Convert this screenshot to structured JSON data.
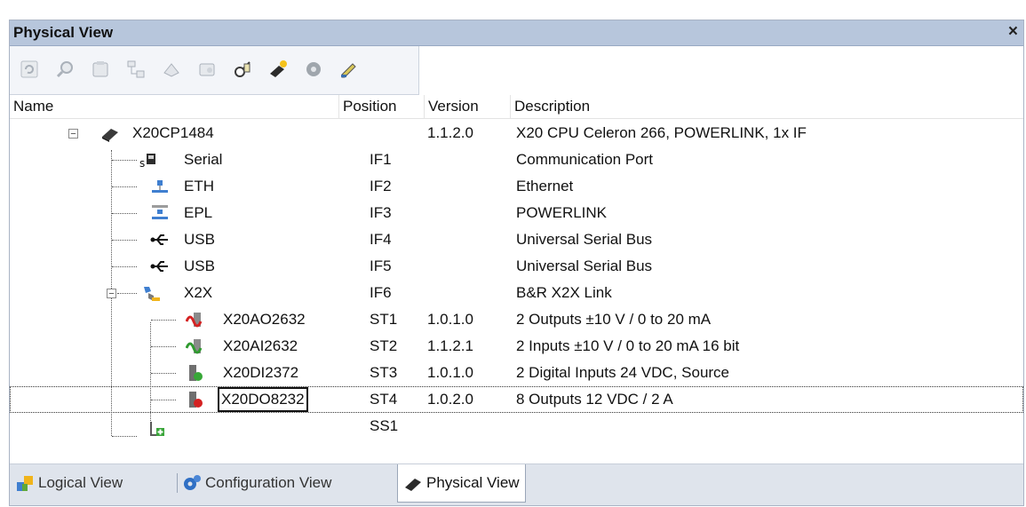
{
  "window": {
    "title": "Physical View",
    "close_label": "×"
  },
  "toolbar": {
    "buttons": [
      "refresh-icon",
      "search-icon",
      "module-icon",
      "hierarchy-icon",
      "compare-icon",
      "open-icon",
      "find-icon",
      "insert-hardware-icon",
      "gear-icon",
      "properties-icon"
    ]
  },
  "columns": {
    "name": "Name",
    "position": "Position",
    "version": "Version",
    "description": "Description"
  },
  "rows": [
    {
      "name": "X20CP1484",
      "position": "",
      "version": "1.1.2.0",
      "description": "X20 CPU Celeron 266, POWERLINK, 1x IF",
      "icon": "cpu-icon"
    },
    {
      "name": "Serial",
      "position": "IF1",
      "version": "",
      "description": "Communication Port",
      "icon": "serial-port-icon"
    },
    {
      "name": "ETH",
      "position": "IF2",
      "version": "",
      "description": "Ethernet",
      "icon": "ethernet-icon"
    },
    {
      "name": "EPL",
      "position": "IF3",
      "version": "",
      "description": "POWERLINK",
      "icon": "powerlink-icon"
    },
    {
      "name": "USB",
      "position": "IF4",
      "version": "",
      "description": "Universal Serial Bus",
      "icon": "usb-icon"
    },
    {
      "name": "USB",
      "position": "IF5",
      "version": "",
      "description": "Universal Serial Bus",
      "icon": "usb-icon"
    },
    {
      "name": "X2X",
      "position": "IF6",
      "version": "",
      "description": "B&R X2X Link",
      "icon": "x2x-link-icon"
    },
    {
      "name": "X20AO2632",
      "position": "ST1",
      "version": "1.0.1.0",
      "description": "2 Outputs ±10 V / 0 to 20 mA",
      "icon": "analog-output-icon"
    },
    {
      "name": "X20AI2632",
      "position": "ST2",
      "version": "1.1.2.1",
      "description": "2 Inputs ±10 V / 0 to 20 mA  16 bit",
      "icon": "analog-input-icon"
    },
    {
      "name": "X20DI2372",
      "position": "ST3",
      "version": "1.0.1.0",
      "description": "2 Digital Inputs 24 VDC, Source",
      "icon": "digital-input-icon"
    },
    {
      "name": "X20DO8232",
      "position": "ST4",
      "version": "1.0.2.0",
      "description": "8 Outputs 12 VDC / 2 A",
      "icon": "digital-output-icon"
    },
    {
      "name": "",
      "position": "SS1",
      "version": "",
      "description": "",
      "icon": "add-slot-icon"
    }
  ],
  "tabs": [
    {
      "label": "Logical View",
      "icon": "logical-view-icon"
    },
    {
      "label": "Configuration View",
      "icon": "configuration-view-icon"
    },
    {
      "label": "Physical View",
      "icon": "physical-view-icon"
    }
  ],
  "colors": {
    "title_bar": "#b7c6dc",
    "tab_bar": "#dfe4ec",
    "selection_border": "#111111"
  }
}
